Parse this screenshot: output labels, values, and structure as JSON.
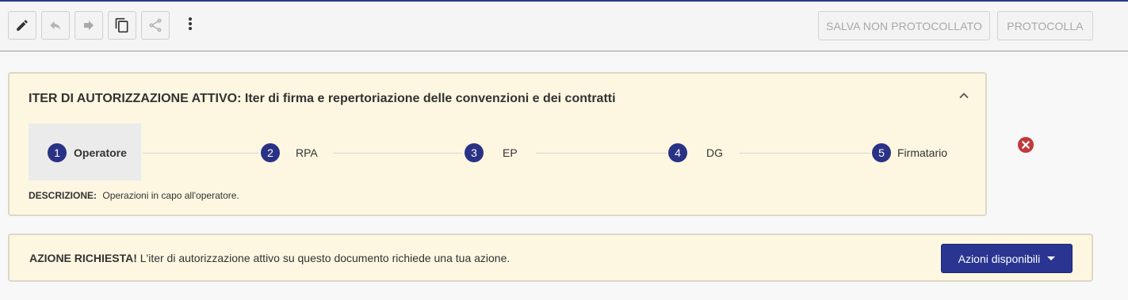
{
  "toolbar": {
    "icons": [
      "edit-icon",
      "reply-icon",
      "forward-icon",
      "copy-icon",
      "share-icon",
      "more-vert-icon"
    ],
    "salva_label": "SALVA NON PROTOCOLLATO",
    "protocolla_label": "PROTOCOLLA"
  },
  "iter_panel": {
    "title_prefix": "ITER DI AUTORIZZAZIONE ATTIVO:",
    "title_name": "Iter di firma e repertoriazione delle convenzioni e dei contratti",
    "steps": [
      {
        "number": "1",
        "label": "Operatore",
        "active": true
      },
      {
        "number": "2",
        "label": "RPA",
        "active": false
      },
      {
        "number": "3",
        "label": "EP",
        "active": false
      },
      {
        "number": "4",
        "label": "DG",
        "active": false
      },
      {
        "number": "5",
        "label": "Firmatario",
        "active": false
      }
    ],
    "description_label": "DESCRIZIONE:",
    "description_text": "Operazioni in capo all'operatore."
  },
  "action_panel": {
    "strong_text": "AZIONE RICHIESTA!",
    "text": "L'iter di autorizzazione attivo su questo documento richiede una tua azione.",
    "button_label": "Azioni disponibili"
  },
  "colors": {
    "accent": "#2a3286",
    "panel_bg": "#fdf6e1",
    "close_red": "#c0393b"
  }
}
